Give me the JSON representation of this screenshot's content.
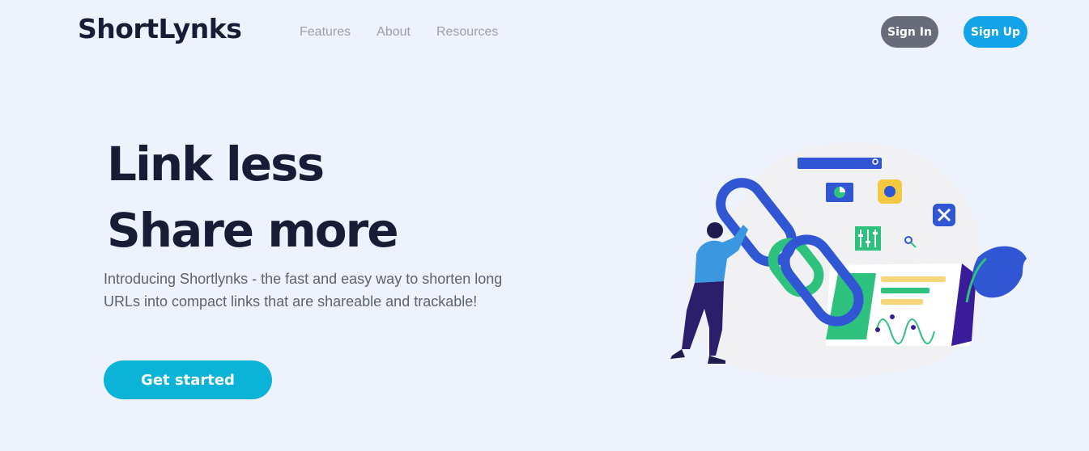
{
  "header": {
    "logo": "ShortLynks",
    "nav": [
      "Features",
      "About",
      "Resources"
    ],
    "sign_in": "Sign In",
    "sign_up": "Sign Up"
  },
  "hero": {
    "line1": "Link less",
    "line2": "Share more",
    "description": "Introducing Shortlynks - the fast and easy way to shorten long URLs into compact links that are shareable and trackable!",
    "cta": "Get started"
  },
  "colors": {
    "background": "#eef2fd",
    "primary_blue": "#13a3e8",
    "cta_cyan": "#0bb4d6",
    "dark_text": "#161d35",
    "chain_blue": "#3056d3",
    "accent_green": "#2ec27e"
  }
}
